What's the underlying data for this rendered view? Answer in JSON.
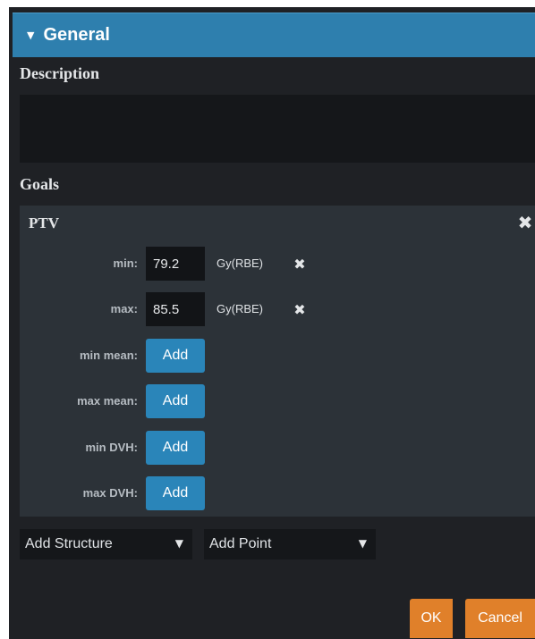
{
  "section": {
    "caret": "▼",
    "title": "General"
  },
  "description": {
    "label": "Description",
    "value": ""
  },
  "goals": {
    "label": "Goals",
    "structure": {
      "name": "PTV",
      "close_icon": "✖",
      "rows": [
        {
          "label": "min:",
          "value": "79.2",
          "unit": "Gy(RBE)",
          "remove_icon": "✖"
        },
        {
          "label": "max:",
          "value": "85.5",
          "unit": "Gy(RBE)",
          "remove_icon": "✖"
        },
        {
          "label": "min mean:",
          "button": "Add"
        },
        {
          "label": "max mean:",
          "button": "Add"
        },
        {
          "label": "min DVH:",
          "button": "Add"
        },
        {
          "label": "max DVH:",
          "button": "Add"
        }
      ]
    }
  },
  "add_structure": {
    "label": "Add Structure",
    "arrow": "▼"
  },
  "add_point": {
    "label": "Add Point",
    "arrow": "▼"
  },
  "footer": {
    "ok_label": "OK",
    "cancel_label": "Cancel"
  },
  "colors": {
    "header": "#2e7fae",
    "background": "#1f2125",
    "card": "#2c3238",
    "input": "#121417",
    "add_button": "#2a85b9",
    "footer_button": "#e0802a"
  }
}
